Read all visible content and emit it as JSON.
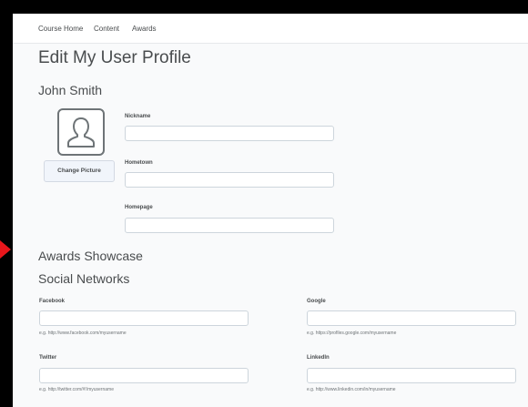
{
  "nav": {
    "items": [
      {
        "label": "Course Home"
      },
      {
        "label": "Content"
      },
      {
        "label": "Awards"
      }
    ]
  },
  "page_title": "Edit My User Profile",
  "user_name": "John Smith",
  "profile": {
    "change_picture_label": "Change Picture",
    "nickname": {
      "label": "Nickname",
      "value": ""
    },
    "hometown": {
      "label": "Hometown",
      "value": ""
    },
    "homepage": {
      "label": "Homepage",
      "value": ""
    }
  },
  "sections": {
    "awards_showcase": "Awards Showcase",
    "social_networks": "Social Networks"
  },
  "social": {
    "facebook": {
      "label": "Facebook",
      "value": "",
      "hint": "e.g. http://www.facebook.com/myusername"
    },
    "google": {
      "label": "Google",
      "value": "",
      "hint": "e.g. https://profiles.google.com/myusername"
    },
    "twitter": {
      "label": "Twitter",
      "value": "",
      "hint": "e.g. http://twitter.com/#!/myusername"
    },
    "linkedin": {
      "label": "LinkedIn",
      "value": "",
      "hint": "e.g. http://www.linkedin.com/in/myusername"
    }
  },
  "colors": {
    "annotation_arrow": "#e8161b",
    "text": "#494c4e"
  },
  "icons": {
    "profile_picture": "user-silhouette-icon",
    "annotation": "red-arrow-icon"
  }
}
